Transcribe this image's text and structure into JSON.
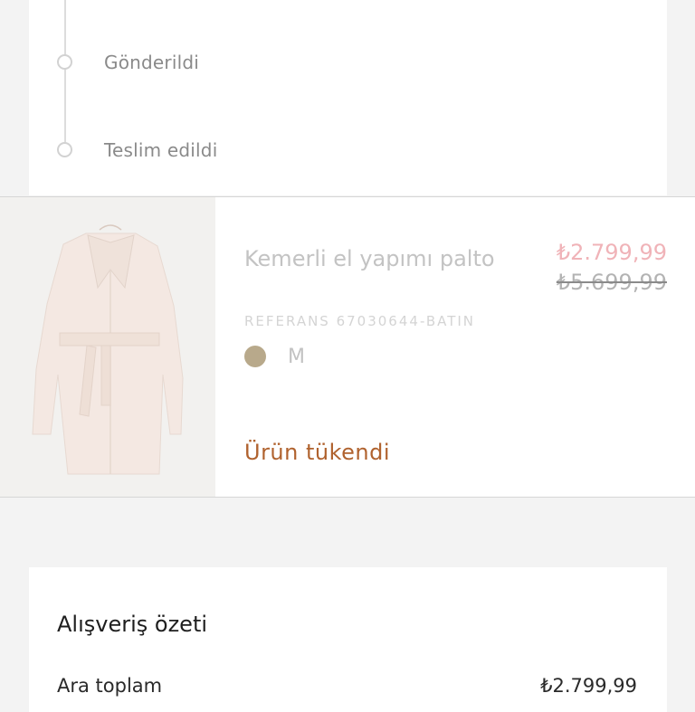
{
  "tracking": {
    "steps": [
      {
        "label": "Gönderildi"
      },
      {
        "label": "Teslim edildi"
      }
    ]
  },
  "product": {
    "name": "Kemerli el yapımı palto",
    "sale_price": "₺2.799,99",
    "original_price": "₺5.699,99",
    "reference": "REFERANS 67030644-BATIN",
    "color_swatch": "#b8a98b",
    "size": "M",
    "status": "Ürün tükendi"
  },
  "summary": {
    "title": "Alışveriş özeti",
    "subtotal_label": "Ara toplam",
    "subtotal_value": "₺2.799,99"
  }
}
